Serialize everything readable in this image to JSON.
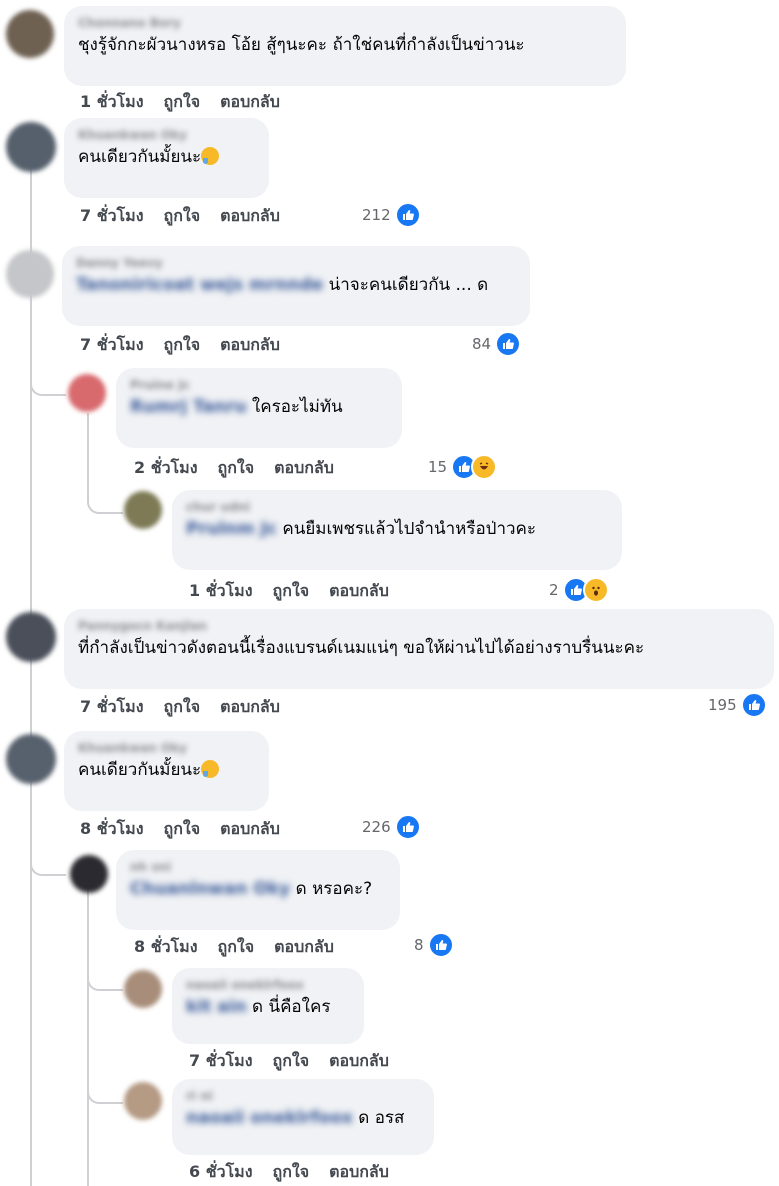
{
  "comments": [
    {
      "name": "Chonnano Bory",
      "tag": "",
      "text": "ชุงรู้จักกะผัวนางหรอ โอ้ย สู้ๆนะคะ ถ้าใช่คนที่กำลังเป็นข่าวนะ",
      "time": "1 ชั่วโมง",
      "like": "ถูกใจ",
      "reply": "ตอบกลับ",
      "count": "",
      "avatar_color": "#6e6152"
    },
    {
      "name": "Khuankwan Oky",
      "tag": "",
      "text": "คนเดียวกันมั้ยนะ",
      "time": "7 ชั่วโมง",
      "like": "ถูกใจ",
      "reply": "ตอบกลับ",
      "count": "212",
      "avatar_color": "#55606c"
    },
    {
      "name": "Danny Yeevy",
      "tag": "Tanoniricoat wejs mrnnde",
      "text": "น่าจะคนเดียวกัน ... ด",
      "time": "7 ชั่วโมง",
      "like": "ถูกใจ",
      "reply": "ตอบกลับ",
      "count": "84",
      "avatar_color": "#c5c6c9"
    },
    {
      "name": "Pruine Jc",
      "tag": "Rumrj Tanru",
      "text": "ใครอะไม่ทัน",
      "time": "2 ชั่วโมง",
      "like": "ถูกใจ",
      "reply": "ตอบกลับ",
      "count": "15",
      "avatar_color": "#d86a6e"
    },
    {
      "name": "chur udni",
      "tag": "Prulnm Jc",
      "text": "คนยืมเพชรแล้วไปจำนำหรือป่าวคะ",
      "time": "1 ชั่วโมง",
      "like": "ถูกใจ",
      "reply": "ตอบกลับ",
      "count": "2",
      "avatar_color": "#7d7a55"
    },
    {
      "name": "Pannygocn Kanjlan",
      "tag": "",
      "text": "ที่กำลังเป็นข่าวดังตอนนี้เรื่องแบรนด์เนมแน่ๆ ขอให้ผ่านไปได้อย่างราบรื่นนะคะ",
      "time": "7 ชั่วโมง",
      "like": "ถูกใจ",
      "reply": "ตอบกลับ",
      "count": "195",
      "avatar_color": "#4a4f5a"
    },
    {
      "name": "Khuankwan Oky",
      "tag": "",
      "text": "คนเดียวกันมั้ยนะ",
      "time": "8 ชั่วโมง",
      "like": "ถูกใจ",
      "reply": "ตอบกลับ",
      "count": "226",
      "avatar_color": "#57616d"
    },
    {
      "name": "nh sni",
      "tag": "Chuanlnwan Oky",
      "text": "ด หรอคะ?",
      "time": "8 ชั่วโมง",
      "like": "ถูกใจ",
      "reply": "ตอบกลับ",
      "count": "8",
      "avatar_color": "#2a2a30"
    },
    {
      "name": "naoaii oneklrfoox",
      "tag": "kit ain",
      "text": "ด นี่คือใคร",
      "time": "7 ชั่วโมง",
      "like": "ถูกใจ",
      "reply": "ตอบกลับ",
      "count": "",
      "avatar_color": "#a88e7a"
    },
    {
      "name": "ri ni",
      "tag": "naoaii oneklrfoox",
      "text": "ด อรส",
      "time": "6 ชั่วโมง",
      "like": "ถูกใจ",
      "reply": "ตอบกลับ",
      "count": "",
      "avatar_color": "#b59a84"
    }
  ]
}
